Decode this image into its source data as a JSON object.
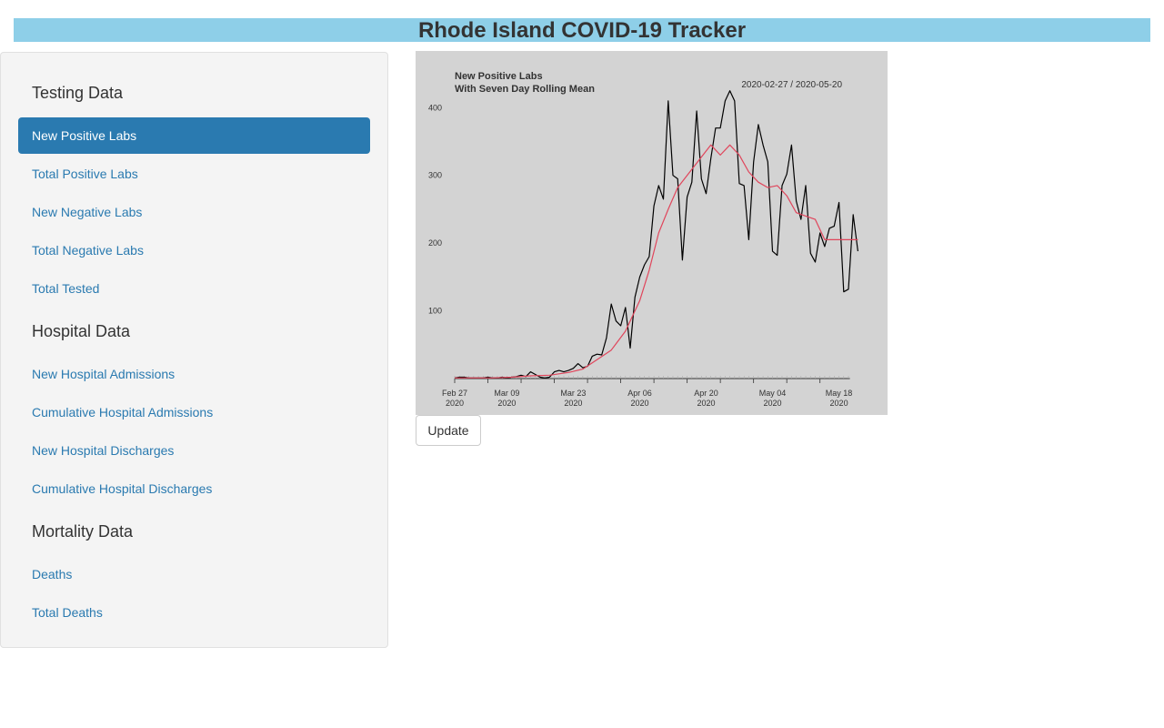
{
  "app": {
    "title": "Rhode Island COVID-19 Tracker"
  },
  "sidebar": {
    "sections": [
      {
        "heading": "Testing Data",
        "items": [
          "New Positive Labs",
          "Total Positive Labs",
          "New Negative Labs",
          "Total Negative Labs",
          "Total Tested"
        ]
      },
      {
        "heading": "Hospital Data",
        "items": [
          "New Hospital Admissions",
          "Cumulative Hospital Admissions",
          "New Hospital Discharges",
          "Cumulative Hospital Discharges"
        ]
      },
      {
        "heading": "Mortality Data",
        "items": [
          "Deaths",
          "Total Deaths"
        ]
      }
    ],
    "active_item": "New Positive Labs"
  },
  "update_button": {
    "label": "Update"
  },
  "colors": {
    "header_bg": "#8ecfe8",
    "active_bg": "#2a7ab0",
    "link": "#2a7ab0",
    "plot_bg": "#d3d3d3",
    "daily_line": "#000000",
    "mean_line": "#e0455b"
  },
  "chart_data": {
    "type": "line",
    "title": "New Positive Labs",
    "subtitle": "With Seven Day Rolling Mean",
    "date_range": "2020-02-27 / 2020-05-20",
    "xlabel": "",
    "ylabel": "",
    "x_tick_labels": [
      {
        "label": "Feb 27",
        "year": "2020",
        "date": "2020-02-27"
      },
      {
        "label": "Mar 09",
        "year": "2020",
        "date": "2020-03-09"
      },
      {
        "label": "Mar 23",
        "year": "2020",
        "date": "2020-03-23"
      },
      {
        "label": "Apr 06",
        "year": "2020",
        "date": "2020-04-06"
      },
      {
        "label": "Apr 20",
        "year": "2020",
        "date": "2020-04-20"
      },
      {
        "label": "May 04",
        "year": "2020",
        "date": "2020-05-04"
      },
      {
        "label": "May 18",
        "year": "2020",
        "date": "2020-05-18"
      }
    ],
    "y_ticks": [
      100,
      200,
      300,
      400
    ],
    "ylim": [
      0,
      430
    ],
    "xlim": [
      "2020-02-27",
      "2020-05-20"
    ],
    "series": [
      {
        "values": [
          [
            "2020-02-27",
            1
          ],
          [
            "2020-02-28",
            2
          ],
          [
            "2020-02-29",
            2
          ],
          [
            "2020-03-01",
            1
          ],
          [
            "2020-03-02",
            1
          ],
          [
            "2020-03-03",
            1
          ],
          [
            "2020-03-04",
            1
          ],
          [
            "2020-03-05",
            2
          ],
          [
            "2020-03-06",
            1
          ],
          [
            "2020-03-07",
            1
          ],
          [
            "2020-03-08",
            2
          ],
          [
            "2020-03-09",
            1
          ],
          [
            "2020-03-10",
            2
          ],
          [
            "2020-03-11",
            3
          ],
          [
            "2020-03-12",
            5
          ],
          [
            "2020-03-13",
            3
          ],
          [
            "2020-03-14",
            10
          ],
          [
            "2020-03-15",
            6
          ],
          [
            "2020-03-16",
            2
          ],
          [
            "2020-03-17",
            1
          ],
          [
            "2020-03-18",
            2
          ],
          [
            "2020-03-19",
            10
          ],
          [
            "2020-03-20",
            12
          ],
          [
            "2020-03-21",
            10
          ],
          [
            "2020-03-22",
            12
          ],
          [
            "2020-03-23",
            15
          ],
          [
            "2020-03-24",
            22
          ],
          [
            "2020-03-25",
            16
          ],
          [
            "2020-03-26",
            18
          ],
          [
            "2020-03-27",
            33
          ],
          [
            "2020-03-28",
            36
          ],
          [
            "2020-03-29",
            35
          ],
          [
            "2020-03-30",
            60
          ],
          [
            "2020-03-31",
            110
          ],
          [
            "2020-04-01",
            85
          ],
          [
            "2020-04-02",
            78
          ],
          [
            "2020-04-03",
            105
          ],
          [
            "2020-04-04",
            45
          ],
          [
            "2020-04-05",
            120
          ],
          [
            "2020-04-06",
            150
          ],
          [
            "2020-04-07",
            168
          ],
          [
            "2020-04-08",
            180
          ],
          [
            "2020-04-09",
            255
          ],
          [
            "2020-04-10",
            285
          ],
          [
            "2020-04-11",
            265
          ],
          [
            "2020-04-12",
            410
          ],
          [
            "2020-04-13",
            300
          ],
          [
            "2020-04-14",
            295
          ],
          [
            "2020-04-15",
            175
          ],
          [
            "2020-04-16",
            268
          ],
          [
            "2020-04-17",
            290
          ],
          [
            "2020-04-18",
            395
          ],
          [
            "2020-04-19",
            295
          ],
          [
            "2020-04-20",
            273
          ],
          [
            "2020-04-21",
            325
          ],
          [
            "2020-04-22",
            370
          ],
          [
            "2020-04-23",
            370
          ],
          [
            "2020-04-24",
            410
          ],
          [
            "2020-04-25",
            425
          ],
          [
            "2020-04-26",
            410
          ],
          [
            "2020-04-27",
            288
          ],
          [
            "2020-04-28",
            285
          ],
          [
            "2020-04-29",
            205
          ],
          [
            "2020-04-30",
            320
          ],
          [
            "2020-05-01",
            375
          ],
          [
            "2020-05-02",
            345
          ],
          [
            "2020-05-03",
            320
          ],
          [
            "2020-05-04",
            188
          ],
          [
            "2020-05-05",
            182
          ],
          [
            "2020-05-06",
            285
          ],
          [
            "2020-05-07",
            302
          ],
          [
            "2020-05-08",
            345
          ],
          [
            "2020-05-09",
            262
          ],
          [
            "2020-05-10",
            235
          ],
          [
            "2020-05-11",
            285
          ],
          [
            "2020-05-12",
            185
          ],
          [
            "2020-05-13",
            172
          ],
          [
            "2020-05-14",
            215
          ],
          [
            "2020-05-15",
            195
          ],
          [
            "2020-05-16",
            222
          ],
          [
            "2020-05-17",
            225
          ],
          [
            "2020-05-18",
            260
          ],
          [
            "2020-05-19",
            128
          ],
          [
            "2020-05-20",
            132
          ],
          [
            "2020-05-21",
            242
          ],
          [
            "2020-05-22",
            188
          ]
        ]
      },
      {
        "values": [
          [
            "2020-02-27",
            1
          ],
          [
            "2020-03-02",
            1
          ],
          [
            "2020-03-06",
            1
          ],
          [
            "2020-03-10",
            2
          ],
          [
            "2020-03-14",
            4
          ],
          [
            "2020-03-18",
            5
          ],
          [
            "2020-03-22",
            9
          ],
          [
            "2020-03-25",
            14
          ],
          [
            "2020-03-28",
            28
          ],
          [
            "2020-03-31",
            42
          ],
          [
            "2020-04-03",
            70
          ],
          [
            "2020-04-06",
            115
          ],
          [
            "2020-04-08",
            160
          ],
          [
            "2020-04-10",
            215
          ],
          [
            "2020-04-12",
            250
          ],
          [
            "2020-04-14",
            282
          ],
          [
            "2020-04-16",
            300
          ],
          [
            "2020-04-18",
            318
          ],
          [
            "2020-04-21",
            345
          ],
          [
            "2020-04-23",
            330
          ],
          [
            "2020-04-25",
            345
          ],
          [
            "2020-04-27",
            330
          ],
          [
            "2020-04-29",
            305
          ],
          [
            "2020-05-01",
            290
          ],
          [
            "2020-05-03",
            282
          ],
          [
            "2020-05-05",
            285
          ],
          [
            "2020-05-07",
            270
          ],
          [
            "2020-05-09",
            245
          ],
          [
            "2020-05-11",
            240
          ],
          [
            "2020-05-13",
            235
          ],
          [
            "2020-05-15",
            205
          ],
          [
            "2020-05-17",
            205
          ],
          [
            "2020-05-19",
            205
          ],
          [
            "2020-05-22",
            205
          ]
        ]
      }
    ],
    "grid": false,
    "legend": "none"
  }
}
